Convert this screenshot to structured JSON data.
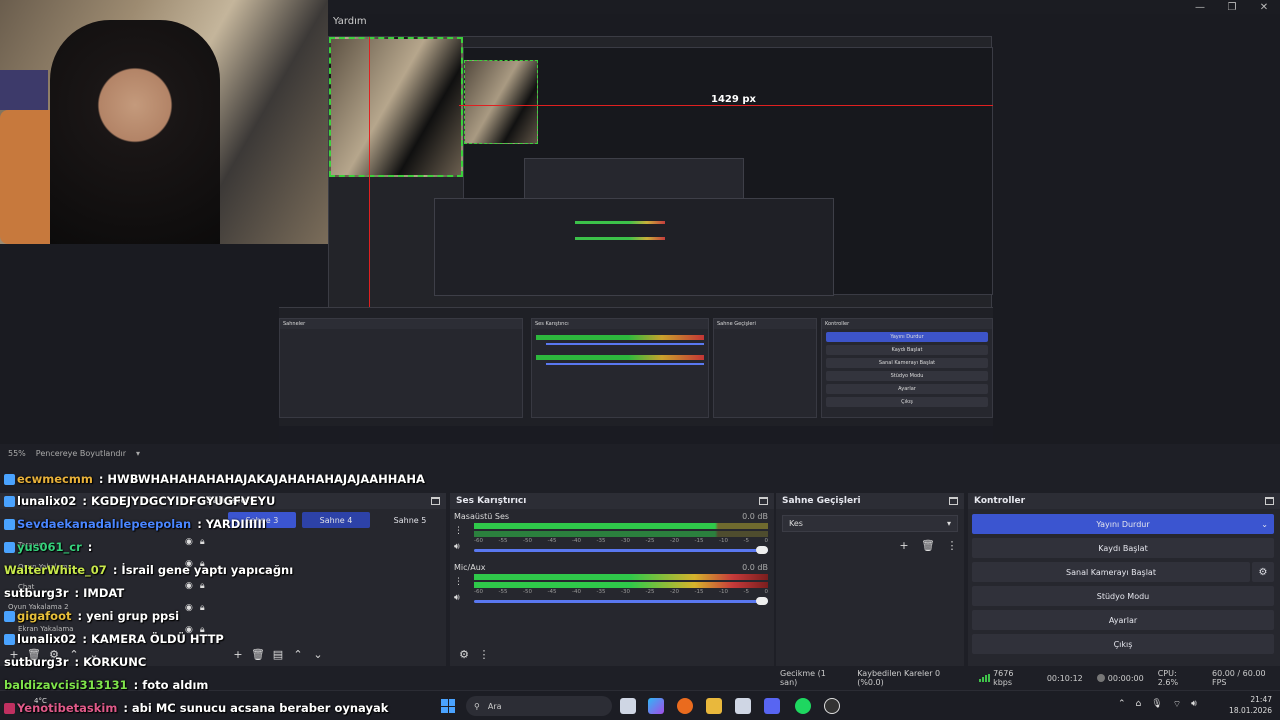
{
  "window": {
    "menu_item": "Yardım",
    "controls": [
      "—",
      "❐",
      "✕"
    ]
  },
  "preview": {
    "measure_label": "1429 px",
    "zoom": "55%",
    "resize_label": "Pencereye Boyutlandır",
    "mini_controls": [
      "Yayını Durdur",
      "Kaydı Başlat",
      "Sanal Kamerayı Başlat",
      "Stüdyo Modu",
      "Ayarlar",
      "Çıkış"
    ]
  },
  "scenes": {
    "title": "Sahneler",
    "tabs": [
      "Sahne 3",
      "Sahne 4",
      "Sahne 5"
    ]
  },
  "sources": {
    "ghost_items": [
      "Oyun Yakalama",
      "Chat",
      "Oyun Yakalama 2",
      "Ekran Yakalama",
      "Tarayıcı"
    ]
  },
  "mixer": {
    "title": "Ses Karıştırıcı",
    "channels": [
      {
        "name": "Masaüstü Ses",
        "db": "0.0 dB",
        "level": 0.82
      },
      {
        "name": "Mic/Aux",
        "db": "0.0 dB",
        "level": 0.98
      }
    ],
    "ticks": [
      "-60",
      "-55",
      "-50",
      "-45",
      "-40",
      "-35",
      "-30",
      "-25",
      "-20",
      "-15",
      "-10",
      "-5",
      "0"
    ]
  },
  "transitions": {
    "title": "Sahne Geçişleri",
    "selected": "Kes"
  },
  "controls": {
    "title": "Kontroller",
    "stop_stream": "Yayını Durdur",
    "start_record": "Kaydı Başlat",
    "virtual_cam": "Sanal Kamerayı Başlat",
    "studio_mode": "Stüdyo Modu",
    "settings": "Ayarlar",
    "exit": "Çıkış"
  },
  "status": {
    "delay": "Gecikme (1 san)",
    "dropped": "Kaybedilen Kareler 0 (%0.0)",
    "bitrate": "7676 kbps",
    "stream_time": "00:10:12",
    "record_time": "00:00:00",
    "cpu": "CPU: 2.6%",
    "fps": "60.00 / 60.00 FPS"
  },
  "taskbar": {
    "search_placeholder": "Ara",
    "time": "21:47",
    "date": "18.01.2026",
    "weather": "4°C"
  },
  "chat": [
    {
      "user": "ecwmecmm",
      "msg": ": HWBWHAHAHAHAHAJAKAJAHAHAHAJAJAAHHAHA",
      "color": "#e8b13a"
    },
    {
      "user": "lunalix02",
      "msg": ": KGDEJYDGCYIDFGYUGFVEYU",
      "color": "#ffffff"
    },
    {
      "user": "Sevdaekanadalılepeepolan",
      "msg": ": YARDIIIIII",
      "color": "#4a86ff"
    },
    {
      "user": "yus061_cr",
      "msg": ":",
      "color": "#36d17c"
    },
    {
      "user": "WalterWhite_07",
      "msg": ": İsrail gene yaptı yapıcağnı",
      "color": "#c8e84b"
    },
    {
      "user": "sutburg3r",
      "msg": ": IMDAT",
      "color": "#ffffff"
    },
    {
      "user": "gigafoot",
      "msg": ": yeni grup ppsi",
      "color": "#e8c03a"
    },
    {
      "user": "lunalix02",
      "msg": ": KAMERA ÖLDÜ HTTP",
      "color": "#ffffff"
    },
    {
      "user": "sutburg3r",
      "msg": ": KORKUNC",
      "color": "#ffffff"
    },
    {
      "user": "baldizavcisi313131",
      "msg": ": foto aldım",
      "color": "#7fe34b"
    },
    {
      "user": "Yenotibetaskim",
      "msg": ": abi MC sunucu acsana beraber oynayak",
      "color": "#e05a8a"
    }
  ],
  "colors": {
    "accent": "#3b55d0",
    "panel": "#26272e",
    "bg": "#1e1f26",
    "meter_green": "#2fc94a",
    "meter_yellow": "#d6b32c",
    "meter_red": "#c63a3a"
  }
}
